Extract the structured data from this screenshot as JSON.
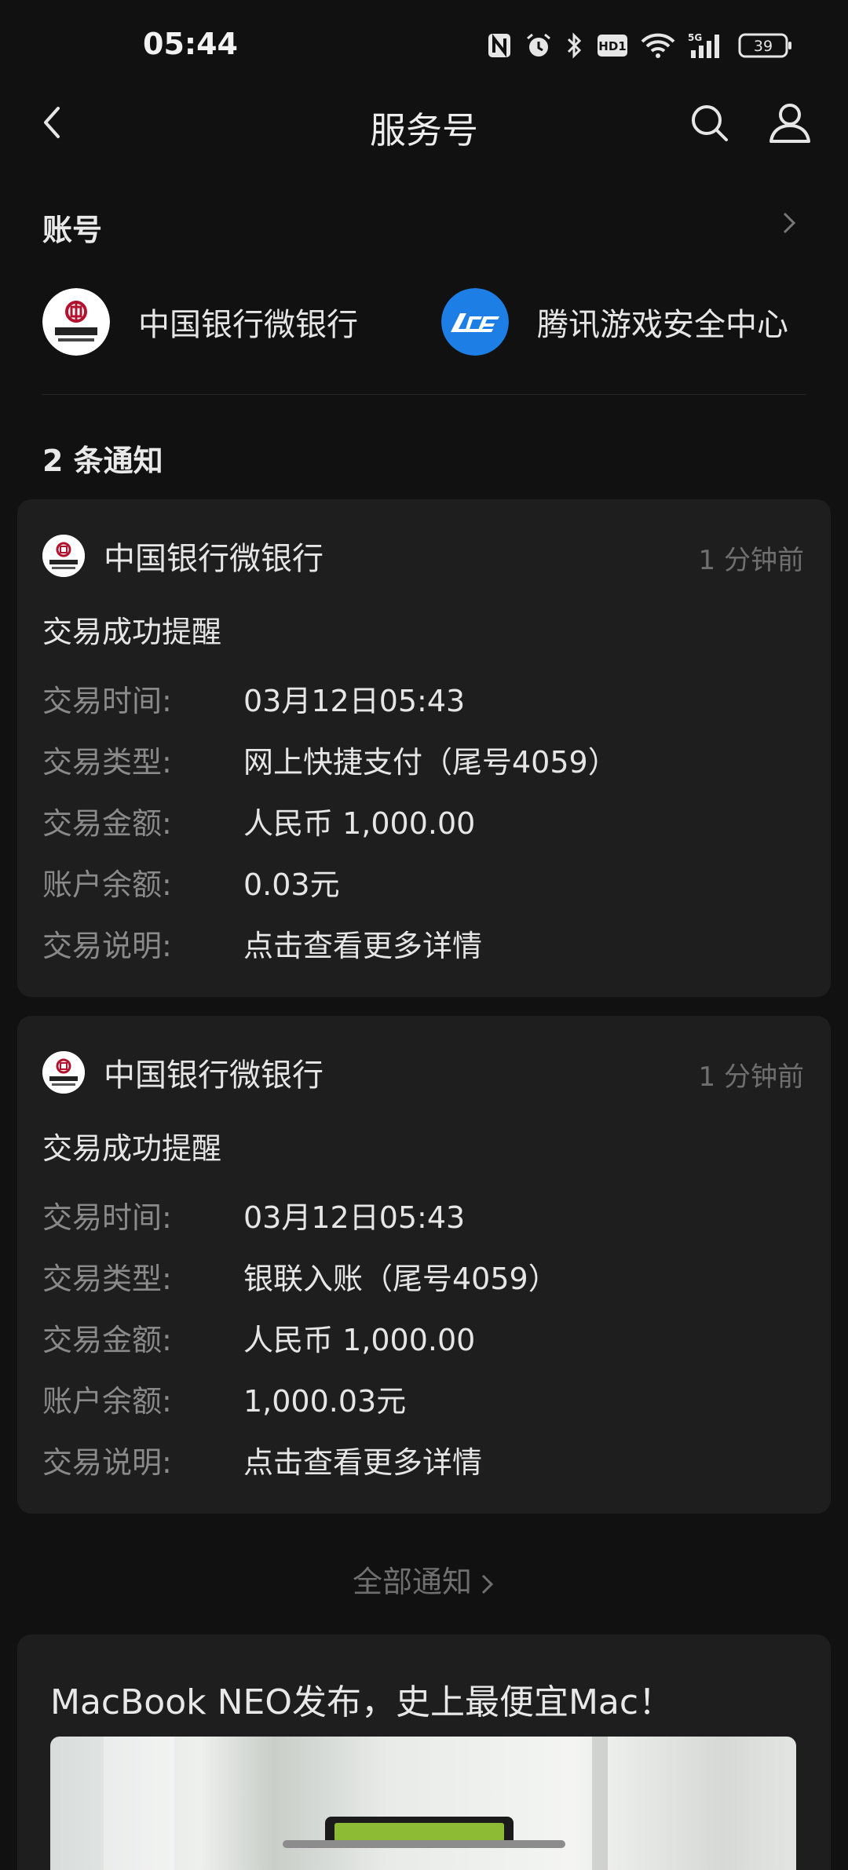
{
  "status_bar": {
    "time": "05:44",
    "battery": "39",
    "network": "5G"
  },
  "header": {
    "title": "服务号"
  },
  "accounts": {
    "heading": "账号",
    "items": [
      {
        "name": "中国银行微银行",
        "logo": "boc-logo"
      },
      {
        "name": "腾讯游戏安全中心",
        "logo": "ace-logo"
      }
    ]
  },
  "notifications": {
    "count_label": "2 条通知",
    "cards": [
      {
        "sender": "中国银行微银行",
        "time": "1 分钟前",
        "subject": "交易成功提醒",
        "rows": [
          {
            "label": "交易时间:",
            "value": "03月12日05:43"
          },
          {
            "label": "交易类型:",
            "value": "网上快捷支付（尾号4059）"
          },
          {
            "label": "交易金额:",
            "value": "人民币 1,000.00"
          },
          {
            "label": "账户余额:",
            "value": "0.03元"
          },
          {
            "label": "交易说明:",
            "value": "点击查看更多详情"
          }
        ]
      },
      {
        "sender": "中国银行微银行",
        "time": "1 分钟前",
        "subject": "交易成功提醒",
        "rows": [
          {
            "label": "交易时间:",
            "value": "03月12日05:43"
          },
          {
            "label": "交易类型:",
            "value": "银联入账（尾号4059）"
          },
          {
            "label": "交易金额:",
            "value": "人民币 1,000.00"
          },
          {
            "label": "账户余额:",
            "value": "1,000.03元"
          },
          {
            "label": "交易说明:",
            "value": "点击查看更多详情"
          }
        ]
      }
    ],
    "all_label": "全部通知"
  },
  "article": {
    "title": "MacBook NEO发布，史上最便宜Mac！"
  },
  "colors": {
    "background": "#111111",
    "card": "#1e1e1e",
    "ace_blue": "#1d7fe6",
    "boc_red": "#b3122e"
  }
}
